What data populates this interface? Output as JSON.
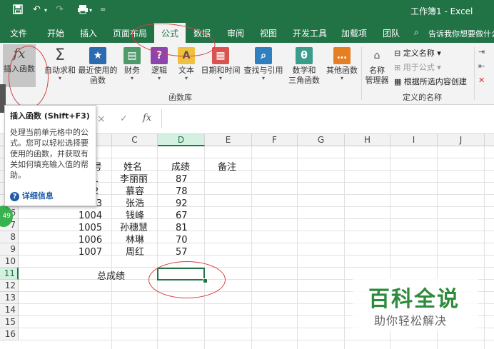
{
  "titlebar": {
    "title": "工作簿1  -  Excel",
    "redo_glyph": "↷",
    "undo_glyph": "↶",
    "save_glyph": "🖫",
    "customize_glyph": "="
  },
  "tabs": [
    "文件",
    "开始",
    "插入",
    "页面布局",
    "公式",
    "数据",
    "审阅",
    "视图",
    "开发工具",
    "加载项",
    "团队"
  ],
  "active_tab": "公式",
  "tell_me": "告诉我你想要做什么",
  "ribbon": {
    "function_library": {
      "items": [
        {
          "label": "插入函数",
          "icon": "fx-icon",
          "glyph": "fx"
        },
        {
          "label": "自动求和",
          "icon": "sigma-icon",
          "glyph": "Σ"
        },
        {
          "label": "最近使用的",
          "label2": "函数",
          "icon": "star-icon",
          "glyph": "★"
        },
        {
          "label": "财务",
          "icon": "finance-book-icon",
          "glyph": "▤"
        },
        {
          "label": "逻辑",
          "icon": "question-book-icon",
          "glyph": "?"
        },
        {
          "label": "文本",
          "icon": "text-book-icon",
          "glyph": "A"
        },
        {
          "label": "日期和时间",
          "icon": "calendar-book-icon",
          "glyph": "▦"
        },
        {
          "label": "查找与引用",
          "icon": "lookup-book-icon",
          "glyph": "⌕"
        },
        {
          "label": "数学和",
          "label2": "三角函数",
          "icon": "math-book-icon",
          "glyph": "θ"
        },
        {
          "label": "其他函数",
          "icon": "more-functions-icon",
          "glyph": "…"
        }
      ],
      "group_label": "函数库"
    },
    "defined_names": {
      "name_manager": {
        "label": "名称",
        "label2": "管理器"
      },
      "define_name": "定义名称",
      "use_in_formula": "用于公式",
      "create_from_selection": "根据所选内容创建",
      "group_label": "定义的名称"
    }
  },
  "formula_bar": {
    "cancel": "×",
    "enter": "✓",
    "fx": "fx",
    "value": ""
  },
  "columns": [
    "C",
    "D",
    "E",
    "F",
    "G",
    "H",
    "I",
    "J"
  ],
  "selected_column": "D",
  "rows": [
    "1",
    "2",
    "3",
    "4",
    "5",
    "6",
    "7",
    "8",
    "9",
    "10",
    "11",
    "12",
    "13",
    "14",
    "15",
    "16"
  ],
  "selected_row": "11",
  "table": {
    "headers": {
      "id_partial": "号",
      "name": "姓名",
      "score": "成绩",
      "note": "备注"
    },
    "records": [
      {
        "id": "1",
        "name": "李丽丽",
        "score": "87"
      },
      {
        "id": "2",
        "name": "慕容",
        "score": "78"
      },
      {
        "id": "1003",
        "name": "张浩",
        "score": "92"
      },
      {
        "id": "1004",
        "name": "钱峰",
        "score": "67"
      },
      {
        "id": "1005",
        "name": "孙穗慧",
        "score": "81"
      },
      {
        "id": "1006",
        "name": "林琳",
        "score": "70"
      },
      {
        "id": "1007",
        "name": "周红",
        "score": "57"
      }
    ],
    "total_label": "总成绩"
  },
  "tooltip": {
    "title": "插入函数 (Shift+F3)",
    "body": "处理当前单元格中的公式。您可以轻松选择要使用的函数，并获取有关如何填充输入值的帮助。",
    "more": "详细信息"
  },
  "badge": "49",
  "watermark": {
    "title": "百科全说",
    "subtitle": "助你轻松解决"
  },
  "colors": {
    "excel_green": "#217346",
    "annotation_red": "#d84040",
    "watermark_green": "#2e8b3c"
  }
}
